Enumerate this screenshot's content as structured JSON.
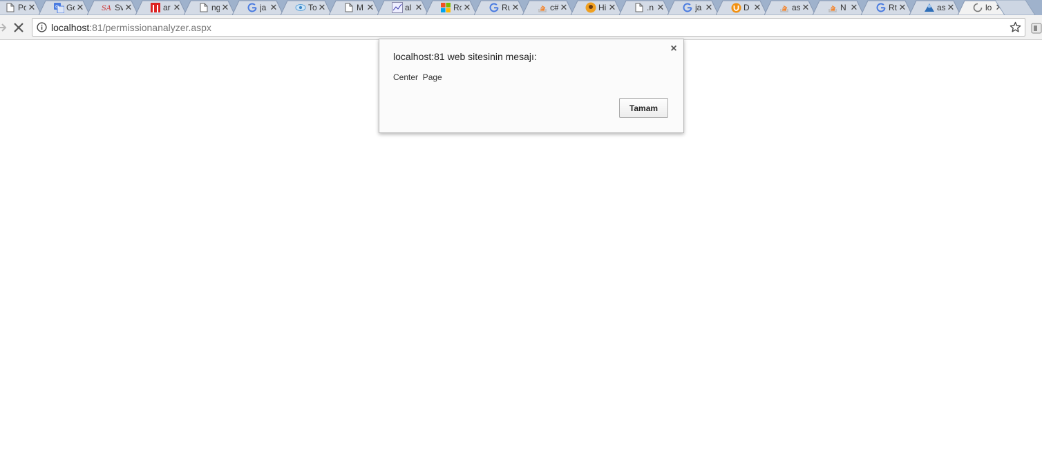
{
  "tabs": [
    {
      "title": "Pc",
      "icon": "document-icon"
    },
    {
      "title": "Go",
      "icon": "google-translate-icon"
    },
    {
      "title": "Sv",
      "icon": "w3schools-icon"
    },
    {
      "title": "ar",
      "icon": "red-n-icon"
    },
    {
      "title": "ng",
      "icon": "document-icon"
    },
    {
      "title": "ja",
      "icon": "google-icon"
    },
    {
      "title": "To",
      "icon": "eye-icon"
    },
    {
      "title": "M",
      "icon": "document-icon"
    },
    {
      "title": "al",
      "icon": "chart-icon"
    },
    {
      "title": "Rc",
      "icon": "microsoft-icon"
    },
    {
      "title": "Ru",
      "icon": "google-icon"
    },
    {
      "title": "c#",
      "icon": "stackoverflow-icon"
    },
    {
      "title": "Hi",
      "icon": "orange-badge-icon"
    },
    {
      "title": ".n",
      "icon": "document-icon"
    },
    {
      "title": "ja",
      "icon": "google-icon"
    },
    {
      "title": "D",
      "icon": "orange-u-icon"
    },
    {
      "title": "as",
      "icon": "stackoverflow-icon"
    },
    {
      "title": "N",
      "icon": "stackoverflow-icon"
    },
    {
      "title": "Rt",
      "icon": "google-icon"
    },
    {
      "title": "as",
      "icon": "blue-person-icon"
    },
    {
      "title": "lo",
      "icon": "loading-spinner-icon",
      "active": true
    }
  ],
  "toolbar": {
    "url_host": "localhost",
    "url_path": ":81/permissionanalyzer.aspx"
  },
  "dialog": {
    "title": "localhost:81 web sitesinin mesajı:",
    "close_label": "×",
    "message": "Center  Page",
    "ok_label": "Tamam"
  },
  "colors": {
    "tabstrip": "#9fb2cc",
    "tab_inactive": "#d4dbe6",
    "tab_active": "#f2f2f2"
  }
}
